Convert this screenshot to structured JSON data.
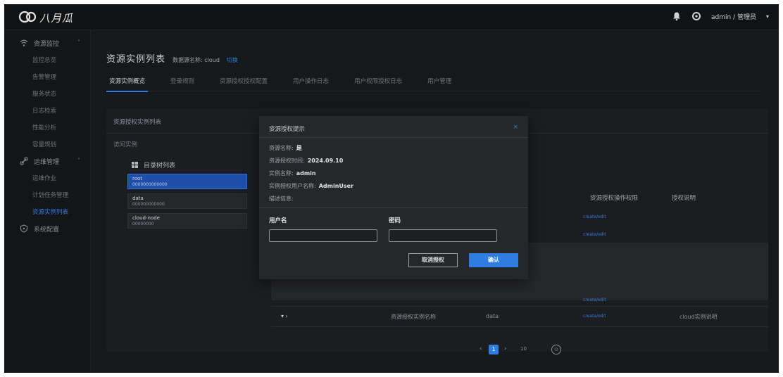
{
  "brand": {
    "logo_text": "八月瓜"
  },
  "topbar": {
    "user": "admin / 管理员"
  },
  "sidebar": {
    "groups": [
      {
        "label": "资源监控",
        "items": [
          "监控总览",
          "告警管理",
          "服务状态",
          "日志检索",
          "性能分析",
          "容量规划"
        ]
      },
      {
        "label": "运维管理",
        "items": [
          "运维作业",
          "计划任务管理",
          "资源实例列表"
        ]
      },
      {
        "label": "系统配置",
        "items": []
      }
    ]
  },
  "page": {
    "title": "资源实例列表",
    "sub": "数据源名称: cloud",
    "link": "切换",
    "tabs": [
      "资源实例概览",
      "登录规则",
      "资源授权授权配置",
      "用户操作日志",
      "用户权限授权日志",
      "用户管理"
    ]
  },
  "panel": {
    "row1": "资源授权实例列表",
    "row2": "访问实例",
    "tree": {
      "title": "目录树列表",
      "nodes": [
        {
          "name": "root",
          "sub": "0000000000000"
        },
        {
          "name": "data",
          "sub": "000000000000"
        },
        {
          "name": "cloud-node",
          "sub": "00000000"
        }
      ]
    },
    "columns": [
      "资源授权操作权限",
      "授权说明"
    ],
    "links": [
      "create/edit",
      "create/edit",
      "create/edit",
      "create/edit"
    ],
    "bottom_row": {
      "toggle": "▾ ›",
      "name": "资源授权实例名称",
      "type": "data",
      "link": "create/edit",
      "desc": "cloud实例说明"
    }
  },
  "pagination": {
    "prev": "‹",
    "current": "1",
    "next": "›",
    "size": "10",
    "jump": "⊙"
  },
  "modal": {
    "title": "资源授权提示",
    "close": "×",
    "info": [
      {
        "label": "资源名称:",
        "value": "是"
      },
      {
        "label": "资源授权时间:",
        "value": "2024.09.10"
      },
      {
        "label": "实例名称:",
        "value": "admin"
      },
      {
        "label": "实例授权用户名称:",
        "value": "AdminUser"
      },
      {
        "label": "描述信息:",
        "value": ""
      }
    ],
    "username_label": "用户名",
    "password_label": "密码",
    "username_value": "",
    "password_value": "",
    "cancel": "取消授权",
    "confirm": "确认"
  }
}
